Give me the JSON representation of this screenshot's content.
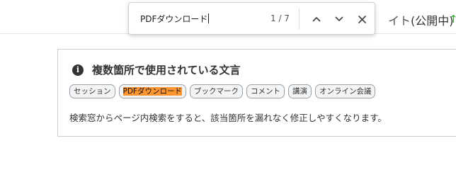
{
  "background_page": {
    "title_prefix": "イト",
    "title_status": "(公開中)",
    "arrow_color": "#3aa53a"
  },
  "find_bar": {
    "query": "PDFダウンロード",
    "match_count": "1 / 7",
    "prev_icon": "chevron-up-icon",
    "next_icon": "chevron-down-icon",
    "close_icon": "close-icon"
  },
  "card": {
    "icon": "info-icon",
    "icon_glyph": "i",
    "title": "複数箇所で使用されている文言",
    "tags": [
      {
        "label": "セッション"
      },
      {
        "label": "PDFダウンロード",
        "highlighted": true
      },
      {
        "label": "ブックマーク"
      },
      {
        "label": "コメント"
      },
      {
        "label": "講演"
      },
      {
        "label": "オンライン会議"
      }
    ],
    "description": "検索窓からページ内検索をすると、該当箇所を漏れなく修正しやすくなります。",
    "highlight_color": "#ff9632"
  }
}
